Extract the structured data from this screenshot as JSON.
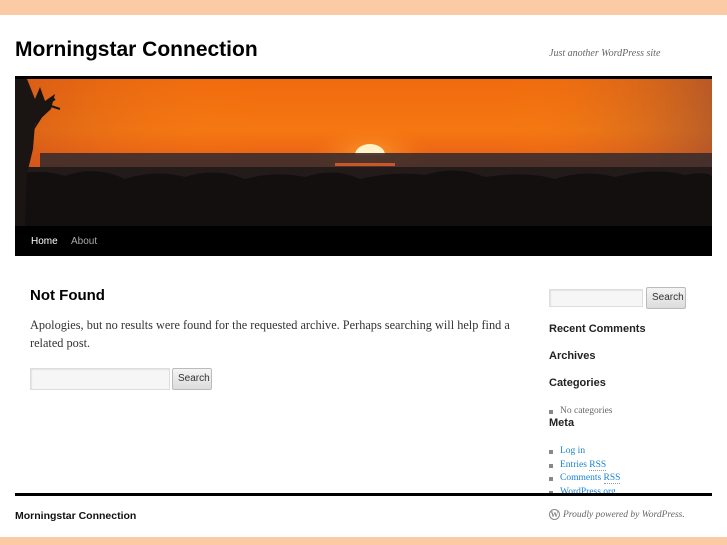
{
  "header": {
    "site_title": "Morningstar Connection",
    "tagline": "Just another WordPress site",
    "banner_alt": "sunset-over-treeline"
  },
  "nav": {
    "items": [
      {
        "label": "Home",
        "active": true
      },
      {
        "label": "About",
        "active": false
      }
    ]
  },
  "main": {
    "title": "Not Found",
    "message": "Apologies, but no results were found for the requested archive. Perhaps searching will help find a related post.",
    "search": {
      "value": "",
      "placeholder": "",
      "button_label": "Search"
    }
  },
  "sidebar": {
    "search": {
      "value": "",
      "placeholder": "",
      "button_label": "Search"
    },
    "widgets": {
      "recent_comments": {
        "title": "Recent Comments"
      },
      "archives": {
        "title": "Archives"
      },
      "categories": {
        "title": "Categories",
        "items": [
          "No categories"
        ]
      },
      "meta": {
        "title": "Meta",
        "items": [
          {
            "label": "Log in"
          },
          {
            "label_pre": "Entries ",
            "abbr": "RSS"
          },
          {
            "label_pre": "Comments ",
            "abbr": "RSS"
          },
          {
            "label": "WordPress.org"
          }
        ]
      }
    }
  },
  "footer": {
    "site_title": "Morningstar Connection",
    "credit": "Proudly powered by WordPress.",
    "credit_icon": "wordpress-logo-icon"
  },
  "colors": {
    "page_background": "#fbcba5",
    "link": "#1982d1",
    "rule": "#000000"
  }
}
